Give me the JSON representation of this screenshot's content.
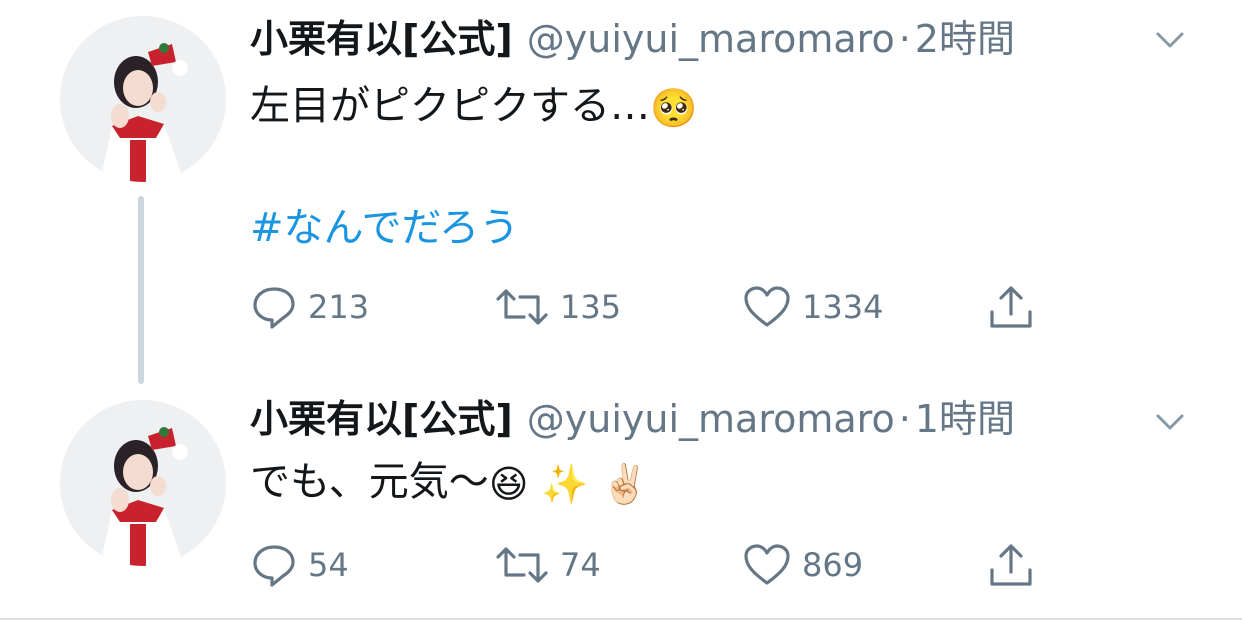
{
  "tweets": [
    {
      "display_name": "小栗有以[公式]",
      "handle": "@yuiyui_maromaro",
      "separator": "·",
      "time": "2時間",
      "text": "左目がピクピクする…",
      "emoji": "🥺",
      "hashtag": "#なんでだろう",
      "replies": "213",
      "retweets": "135",
      "likes": "1334",
      "avatar_icon": "profile-photo"
    },
    {
      "display_name": "小栗有以[公式]",
      "handle": "@yuiyui_maromaro",
      "separator": "·",
      "time": "1時間",
      "text": "でも、元気〜",
      "emojis": [
        "😆",
        "✨",
        "✌🏻"
      ],
      "replies": "54",
      "retweets": "74",
      "likes": "869",
      "avatar_icon": "profile-photo"
    }
  ],
  "colors": {
    "text": "#14171a",
    "secondary": "#657786",
    "link": "#1b95e0",
    "thread_line": "#ccd6dd"
  },
  "icons": {
    "reply": "speech-bubble-icon",
    "retweet": "retweet-arrows-icon",
    "like": "heart-outline-icon",
    "share": "share-upload-icon",
    "more": "chevron-down-icon"
  }
}
